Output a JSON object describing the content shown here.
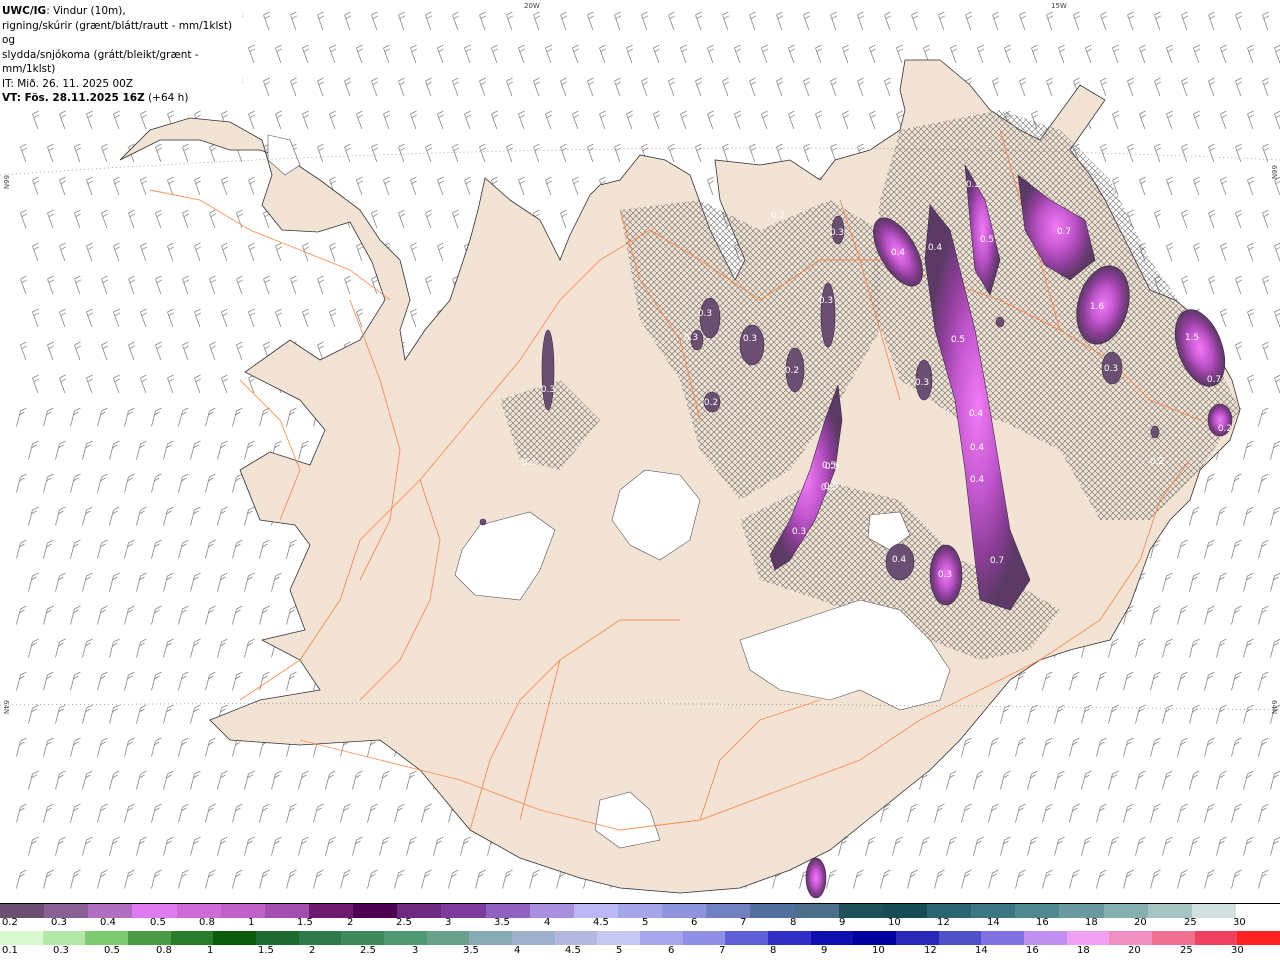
{
  "header": {
    "model": "UWC/IG",
    "line1": ": Vindur (10m),",
    "line2": "rigning/skúrir (grænt/blátt/rautt - mm/1klst) og",
    "line3": "slydda/snjókoma (grátt/bleikt/grænt - mm/1klst)",
    "issue": "IT: Mið. 26. 11. 2025 00Z",
    "valid": "VT: Fös. 28.11.2025 16Z",
    "lead": " (+64 h)"
  },
  "graticule": {
    "lon_20w": "20W",
    "lon_15w": "15W",
    "lat_66_left": "66N",
    "lat_66_right": "66N",
    "lat_64_left": "64N",
    "lat_64_right": "64N"
  },
  "colors": {
    "land": "#f2e3d5",
    "sea": "#ffffff",
    "roads": "#ff7e3a",
    "coast": "#333333",
    "glacier": "#ffffff"
  },
  "precip_labels": [
    "0.3",
    "0.3",
    "0.3",
    "0.3",
    "0.2",
    "0.2",
    "0.3",
    "0.3",
    "0.2",
    "0.3",
    "0.4",
    "0.4",
    "0.5",
    "0.7",
    "1.6",
    "0.5",
    "0.5",
    "0.3",
    "0.3",
    "0.5",
    "0.5",
    "0.4",
    "0.4",
    "0.4",
    "0.3",
    "0.3",
    "0.7",
    "1.5",
    "0.7",
    "0.2",
    "0.2",
    "0.3",
    "0.4",
    "0.2"
  ],
  "legend_snow": {
    "colors": [
      "#6b4f73",
      "#8a5f95",
      "#b06fc0",
      "#e07af0",
      "#d06ad8",
      "#c060c8",
      "#a24fb0",
      "#6e1a6e",
      "#4c0050",
      "#6d2a80",
      "#7d3c9c",
      "#8f61c0",
      "#a890e0",
      "#bcb8f5",
      "#a5a5ea",
      "#8f95dd",
      "#7080c0",
      "#52709e",
      "#4c6f8c",
      "#1e5058",
      "#184c55",
      "#2b6570",
      "#3c7682",
      "#4f8890",
      "#6a9aa0",
      "#86b0b0",
      "#a6c6c4",
      "#d2e0e0",
      "#ffffff"
    ],
    "labels": [
      "0.2",
      "0.3",
      "0.4",
      "0.5",
      "0.8",
      "1",
      "1.5",
      "2",
      "2.5",
      "3",
      "3.5",
      "4",
      "4.5",
      "5",
      "6",
      "7",
      "8",
      "9",
      "10",
      "12",
      "14",
      "16",
      "18",
      "20",
      "25",
      "30"
    ]
  },
  "legend_rain": {
    "colors": [
      "#d8f8d0",
      "#b4e8a8",
      "#7fcb72",
      "#4b9a45",
      "#2a7b2a",
      "#0c5b0c",
      "#1e6a30",
      "#2e7a48",
      "#3e8a5e",
      "#4f9a72",
      "#6ba08c",
      "#87aab4",
      "#9eb0cc",
      "#b2b8e0",
      "#c8c8f5",
      "#a6a6ee",
      "#8f8fe6",
      "#6060d6",
      "#3030c8",
      "#1010b0",
      "#0000a0",
      "#2828b8",
      "#5050c8",
      "#8070e0",
      "#c090f0",
      "#f0a0f0",
      "#f090c0",
      "#f07090",
      "#f04060",
      "#ff2020"
    ],
    "labels": [
      "0.1",
      "0.3",
      "0.5",
      "0.8",
      "1",
      "1.5",
      "2",
      "2.5",
      "3",
      "3.5",
      "4",
      "4.5",
      "5",
      "6",
      "7",
      "8",
      "9",
      "10",
      "12",
      "14",
      "16",
      "18",
      "20",
      "25",
      "30"
    ]
  }
}
